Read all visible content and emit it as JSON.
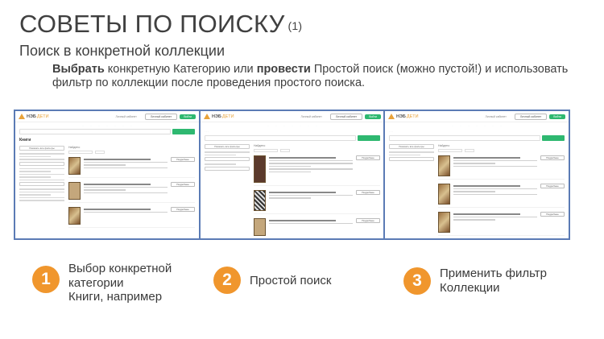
{
  "slide": {
    "title": "СОВЕТЫ ПО ПОИСКУ",
    "title_num": "(1)",
    "subtitle": "Поиск в конкретной коллекции",
    "instruction": {
      "bold1": "Выбрать",
      "text1": " конкретную Категорию или ",
      "bold2": "провести",
      "text2": " Простой поиск (можно пустой!) и использовать фильтр по коллекции после проведения простого поиска."
    }
  },
  "screenshots": {
    "logo": "НЭБ",
    "logo_suffix": "ДЕТИ",
    "header_link": "Личный кабинет",
    "header_button_outline": "Личный кабинет",
    "header_button_green": "Войти",
    "shot1": {
      "category_heading": "Книги",
      "results_label": "Найдено",
      "side_button": "Показать все фильтры",
      "more_button": "Подробнее"
    },
    "shot2": {
      "results_label": "Найдено",
      "side_button": "Показать все фильтры",
      "more_button": "Подробнее"
    },
    "shot3": {
      "results_label": "Найдено",
      "side_button": "Показать все фильтры",
      "more_button": "Подробнее"
    }
  },
  "steps": [
    {
      "number": "1",
      "line1": "Выбор конкретной",
      "line2": "категории",
      "line3": "Книги, например"
    },
    {
      "number": "2",
      "line1": "Простой поиск"
    },
    {
      "number": "3",
      "line1": "Применить фильтр",
      "line2": "Коллекции"
    }
  ],
  "colors": {
    "accent_orange": "#f0962d",
    "frame_blue": "#5b7bb5",
    "site_green": "#2eb870"
  }
}
